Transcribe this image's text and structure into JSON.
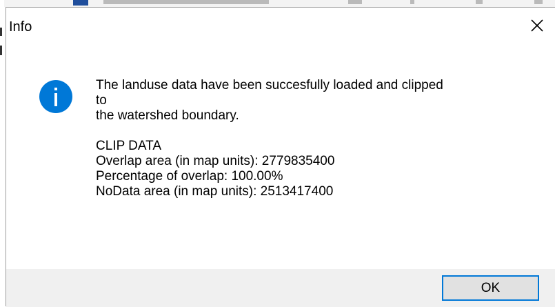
{
  "dialog": {
    "title": "Info",
    "close_icon": "close-icon",
    "icon": "info-icon",
    "accent_color": "#0078d7",
    "message": {
      "line1": "The landuse data have been succesfully loaded and clipped",
      "line2": "to",
      "line3": "the watershed boundary.",
      "section_heading": "CLIP DATA",
      "overlap_area": "Overlap area (in map units): 2779835400",
      "overlap_percentage": "Percentage of overlap: 100.00%",
      "nodata_area": "NoData area (in map units): 2513417400"
    },
    "ok_label": "OK"
  }
}
